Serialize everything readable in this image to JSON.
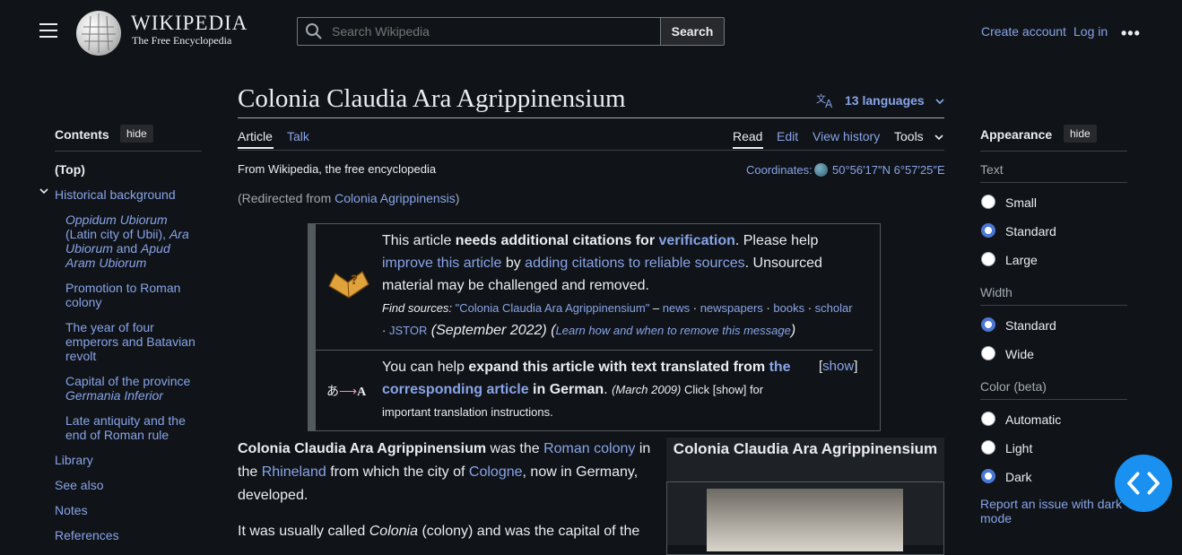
{
  "header": {
    "wordmark": "WIKIPEDIA",
    "tagline": "The Free Encyclopedia",
    "search_placeholder": "Search Wikipedia",
    "search_button": "Search",
    "create_account": "Create account",
    "login": "Log in",
    "more": "•••"
  },
  "toc": {
    "title": "Contents",
    "hide": "hide",
    "top": "(Top)",
    "sections": [
      {
        "label": "Historical background"
      },
      {
        "label": "Library"
      },
      {
        "label": "See also"
      },
      {
        "label": "Notes"
      },
      {
        "label": "References"
      }
    ],
    "subsections": [
      {
        "a": "Oppidum Ubiorum",
        "b": " (Latin city of Ubii), ",
        "c": "Ara Ubiorum",
        "d": " and ",
        "e": "Apud Aram Ubiorum"
      },
      {
        "label": "Promotion to Roman colony"
      },
      {
        "label": "The year of four emperors and Batavian revolt"
      },
      {
        "a": "Capital of the province ",
        "b": "Germania Inferior"
      },
      {
        "label": "Late antiquity and the end of Roman rule"
      }
    ]
  },
  "article": {
    "title": "Colonia Claudia Ara Agrippinensium",
    "languages": "13 languages",
    "tabs": {
      "article": "Article",
      "talk": "Talk",
      "read": "Read",
      "edit": "Edit",
      "history": "View history",
      "tools": "Tools"
    },
    "from": "From Wikipedia, the free encyclopedia",
    "coords_label": "Coordinates:",
    "coords_value": "50°56′17″N 6°57′25″E",
    "redirect_prefix": "(Redirected from ",
    "redirect_link": "Colonia Agrippinensis",
    "redirect_suffix": ")"
  },
  "ambox1": {
    "t1": "This article ",
    "t2": "needs additional citations for ",
    "t3": "verification",
    "t4": ". Please help ",
    "t5": "improve this article",
    "t6": " by ",
    "t7": "adding citations to reliable sources",
    "t8": ". Unsourced material may be challenged and removed.",
    "find": "Find sources:",
    "q": "\"Colonia Claudia Ara Agrippinensium\"",
    "dash": " – ",
    "news": "news",
    "newspapers": "newspapers",
    "books": "books",
    "scholar": "scholar",
    "jstor": "JSTOR",
    "sep": " · ",
    "date": " (September 2022) ",
    "learn": "Learn how and when to remove this message",
    "po": "(",
    "pc": ")"
  },
  "ambox2": {
    "t1": "You can help ",
    "t2": "expand this article with text translated from ",
    "t3": "the corresponding article",
    "t4": " in German",
    "t5": ". ",
    "date": "(March 2009)",
    "t6": " Click [show] for important translation instructions.",
    "show_l": "[",
    "show": "show",
    "show_r": "]",
    "icon_text": "あ",
    "icon_arrow": "⟶",
    "icon_a": "A"
  },
  "body": {
    "p1a": "Colonia Claudia Ara Agrippinensium",
    "p1b": " was the ",
    "p1c": "Roman colony",
    "p1d": " in the ",
    "p1e": "Rhineland",
    "p1f": " from which the city of ",
    "p1g": "Cologne",
    "p1h": ", now in Germany, developed.",
    "p2a": "It was usually called ",
    "p2b": "Colonia",
    "p2c": " (colony) and was the capital of the"
  },
  "infobox": {
    "title": "Colonia Claudia Ara Agrippinensium"
  },
  "appearance": {
    "title": "Appearance",
    "hide": "hide",
    "text_label": "Text",
    "text_opts": [
      "Small",
      "Standard",
      "Large"
    ],
    "width_label": "Width",
    "width_opts": [
      "Standard",
      "Wide"
    ],
    "color_label": "Color (beta)",
    "color_opts": [
      "Automatic",
      "Light",
      "Dark"
    ],
    "report": "Report an issue with dark mode"
  },
  "colors": {
    "link": "#88a3e8",
    "background": "#101418",
    "accent": "#1a91f0",
    "radio_on": "#4b77d6"
  }
}
